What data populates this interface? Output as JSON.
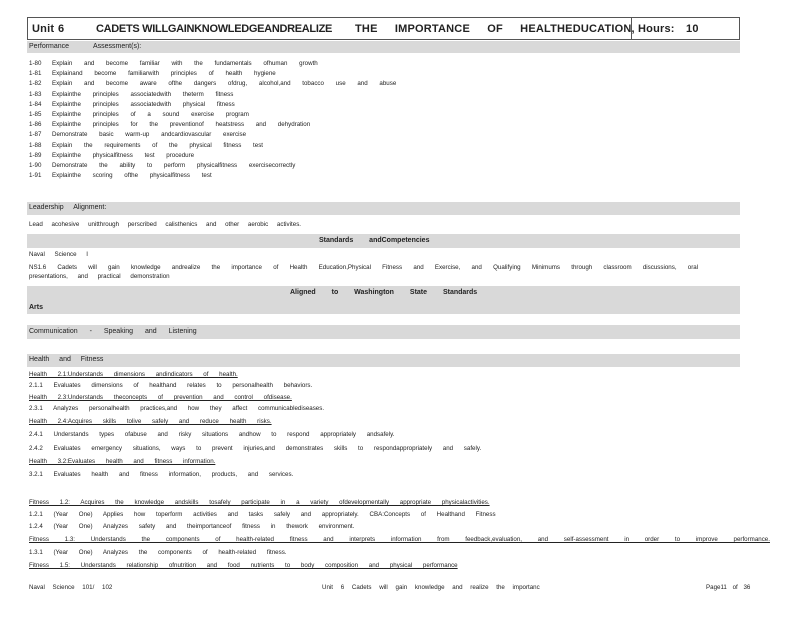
{
  "header": {
    "unit_label": "Unit",
    "unit_number": "6",
    "title_left": "CADETS WILLGAINKNOWLEDGEANDREALIZE",
    "title_right": "THE IMPORTANCE OF HEALTHEDUCATION,",
    "hours_label": "Hours:",
    "hours_value": "10"
  },
  "performance": {
    "label": "Performance",
    "assessment_label": "Assessment(s):",
    "items": [
      {
        "code": "1-80",
        "text": "Explain and become familiar with the fundamentals ofhuman growth"
      },
      {
        "code": "1-81",
        "text": "Explainand become familiarwith principles of health hygiene"
      },
      {
        "code": "1-82",
        "text": "Explain and become aware ofthe dangers ofdrug, alcohol,and tobacco use and abuse"
      },
      {
        "code": "1-83",
        "text": "Explainthe principles associatedwith theterm fitness"
      },
      {
        "code": "1-84",
        "text": "Explainthe principles associatedwith physical fitness"
      },
      {
        "code": "1-85",
        "text": "Explainthe principles of a sound exercise program"
      },
      {
        "code": "1-86",
        "text": "Explainthe principles for the preventionof heatstress and dehydration"
      },
      {
        "code": "1-87",
        "text": "Demonstrate basic warm-up andcardiovascular exercise"
      },
      {
        "code": "1-88",
        "text": "Explain the requirements of the physical fitness test"
      },
      {
        "code": "1-89",
        "text": "Explainthe physicalfitness test procedure"
      },
      {
        "code": "1-90",
        "text": "Demonstrate the ability to perform physicalfitness exercisecorrectly"
      },
      {
        "code": "1-91",
        "text": "Explainthe scoring ofthe physicalfitness test"
      }
    ]
  },
  "leadership": {
    "label": "Leadership Alignment:",
    "text": "Lead acohesive unitthrough perscribed calisthenics and other aerobic activites."
  },
  "standards": {
    "heading": "Standards andCompetencies",
    "subject": "Naval Science I",
    "ns_line1": "NS1.6 Cadets will gain knowledge andrealize the importance of Health Education,Physical Fitness and Exercise, and Qualifying Minimums through classroom discussions, oral",
    "ns_line2": "presentations, and practical demonstration"
  },
  "washington": {
    "heading": "Aligned to Washington State Standards",
    "arts_label": "Arts",
    "communication_label": "Communication - Speaking and Listening"
  },
  "health": {
    "heading": "Health and Fitness",
    "lines": [
      {
        "text": "Health 2.1:Understands dimensions andindicators of health.",
        "underline": true
      },
      {
        "text": "2.1.1 Evaluates dimensions of healthand relates to personalhealth behaviors.",
        "underline": false
      },
      {
        "text": "Health 2.3:Understands theconcepts of prevention and control ofdisease.",
        "underline": true
      },
      {
        "text": "2.3.1 Analyzes personalhealth practices,and how they affect communicablediseases.",
        "underline": false
      },
      {
        "text": "Health 2.4:Acquires skills tolive safely and reduce health risks.",
        "underline": true
      },
      {
        "text": "2.4.1 Understands types ofabuse and risky situations andhow to respond appropriately andsafely.",
        "underline": false
      },
      {
        "text": "2.4.2 Evaluates emergency situations, ways to prevent injuries,and demonstrates skills to respondappropriately and safely.",
        "underline": false
      },
      {
        "text": "Health 3.2:Evaluates health and fitness information.",
        "underline": true
      },
      {
        "text": "3.2.1 Evaluates health and fitness information, products, and services.",
        "underline": false
      }
    ]
  },
  "fitness": {
    "lines": [
      {
        "text": "Fitness 1.2: Acquires the knowledge andskills tosafely participate in a variety ofdevelopmentally appropriate physicalactivities.",
        "underline": true
      },
      {
        "text": "1.2.1 (Year One) Applies how toperform activities and tasks safely and appropriately. CBA:Concepts of Healthand Fitness",
        "underline": false
      },
      {
        "text": "1.2.4 (Year One) Analyzes safety and theimportanceof fitness in thework environment.",
        "underline": false
      },
      {
        "text": "Fitness 1.3: Understands the components of health-related fitness and interprets information from feedback,evaluation, and self-assessment in order to improve performance.",
        "underline": true
      },
      {
        "text": "1.3.1 (Year One) Analyzes the components of health-related fitness.",
        "underline": false
      },
      {
        "text": "Fitness 1.5: Understands relationship ofnutrition and food nutrients to body composition and physical performance",
        "underline": true
      }
    ]
  },
  "footer": {
    "left": "Naval Science 101/ 102",
    "center": "Unit 6 Cadets will gain knowledge and realize the importanc",
    "right": "Page11 of 36"
  }
}
